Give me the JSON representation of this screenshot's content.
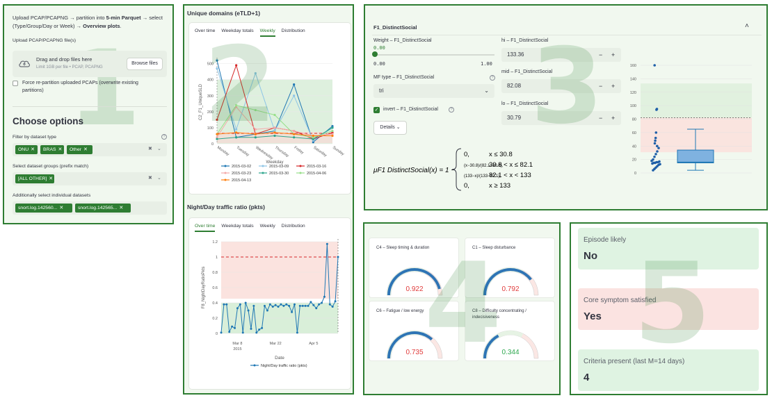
{
  "panel1": {
    "intro_a": "Upload PCAP/PCAPNG → partition into ",
    "intro_b": "5-min Parquet",
    "intro_c": " → select (Type/Group/Day or Week) → ",
    "intro_d": "Overview plots",
    "intro_e": ".",
    "upload_label": "Upload PCAP/PCAPNG file(s)",
    "drop_title": "Drag and drop files here",
    "drop_limit": "Limit 1GB per file • PCAP, PCAPNG",
    "browse_label": "Browse files",
    "force_label": "Force re-partition uploaded PCAPs (overwrite existing partitions)",
    "options_title": "Choose options",
    "filter_label": "Filter by dataset type",
    "type_tags": [
      "ONU",
      "BRAS",
      "Other"
    ],
    "groups_label": "Select dataset groups (prefix match)",
    "group_tags": [
      "[ALL OTHER]"
    ],
    "datasets_label": "Additionally select individual datasets",
    "dataset_tags": [
      "snort.log.142560...",
      "snort.log.142565..."
    ],
    "overlay_number": "1"
  },
  "panel2": {
    "top_title": "Unique domains (eTLD+1)",
    "top_tabs": [
      "Over time",
      "Weekday totals",
      "Weekly",
      "Distribution"
    ],
    "top_active_tab": 2,
    "top_ylabel": "C2_F1_UniqueSLD",
    "top_xlabel": "Weekday",
    "top_yticks": [
      "0",
      "100",
      "200",
      "300",
      "400",
      "500"
    ],
    "top_xticks": [
      "Monday",
      "Tuesday",
      "Wednesday",
      "Thursday",
      "Friday",
      "Saturday",
      "Sunday"
    ],
    "top_legend": [
      {
        "label": "2015-03-02",
        "color": "#1f77b4"
      },
      {
        "label": "2015-03-09",
        "color": "#8ec5e6"
      },
      {
        "label": "2015-03-16",
        "color": "#d62728"
      },
      {
        "label": "2015-03-23",
        "color": "#f4a9a8"
      },
      {
        "label": "2015-03-30",
        "color": "#2ca58d"
      },
      {
        "label": "2015-04-06",
        "color": "#98df8a"
      },
      {
        "label": "2015-04-13",
        "color": "#ff7f0e"
      }
    ],
    "bottom_title": "Night/Day traffic ratio (pkts)",
    "bottom_tabs": [
      "Over time",
      "Weekday totals",
      "Weekly",
      "Distribution"
    ],
    "bottom_active_tab": 0,
    "bottom_ylabel": "F8_NightDayRatioPkts",
    "bottom_xlabel": "Date",
    "bottom_yticks": [
      "0",
      "0.2",
      "0.4",
      "0.6",
      "0.8",
      "1",
      "1.2"
    ],
    "bottom_xticks": [
      "Mar 8",
      "Mar 22",
      "Apr 5"
    ],
    "bottom_xyear": "2015",
    "bottom_legend": "Night/Day traffic ratio (pkts)",
    "overlay_number": "2"
  },
  "panel3": {
    "expander_title": "F1_DistinctSocial",
    "weight_label": "Weight – F1_DistinctSocial",
    "weight_value": "0.00",
    "weight_min": "0.00",
    "weight_max": "1.00",
    "mf_label": "MF type – F1_DistinctSocial",
    "mf_value": "tri",
    "invert_label": "invert – F1_DistinctSocial",
    "details_label": "Details",
    "hi_label": "hi – F1_DistinctSocial",
    "hi_value": "133.36",
    "mid_label": "mid – F1_DistinctSocial",
    "mid_value": "82.08",
    "lo_label": "lo – F1_DistinctSocial",
    "lo_value": "30.79",
    "formula_lhs": "μF1 DistinctSocial(x) = 1 −",
    "formula_cases": [
      {
        "val": "0,",
        "cond": "x ≤ 30.8"
      },
      {
        "val": "(x−30.8)/(82.1−30.8),",
        "cond": "30.8 < x ≤ 82.1"
      },
      {
        "val": "(133−x)/(133−82.1),",
        "cond": "82.1 < x < 133"
      },
      {
        "val": "0,",
        "cond": "x ≥ 133"
      }
    ],
    "box_yticks": [
      "0",
      "20",
      "40",
      "60",
      "80",
      "100",
      "120",
      "140",
      "160"
    ],
    "overlay_number": "3"
  },
  "panel4": {
    "gauges": [
      {
        "title": "C4 – Sleep timing & duration",
        "value": "0.922",
        "color": "#e03b3b"
      },
      {
        "title": "C1 – Sleep disturbance",
        "value": "0.792",
        "color": "#e03b3b"
      },
      {
        "title": "C6 – Fatigue / low energy",
        "value": "0.735",
        "color": "#e03b3b"
      },
      {
        "title": "C8 – Difficulty concentrating / indecisiveness",
        "value": "0.344",
        "color": "#2ea84f"
      }
    ],
    "overlay_number": "4"
  },
  "panel5": {
    "metrics": [
      {
        "title": "Episode likely",
        "value": "No",
        "bg": "#dff3e2"
      },
      {
        "title": "Core symptom satisfied",
        "value": "Yes",
        "bg": "#fbe3e1"
      },
      {
        "title": "Criteria present (last M=14 days)",
        "value": "4",
        "bg": "#dff3e2"
      }
    ],
    "overlay_number": "5"
  },
  "chart_data": [
    {
      "type": "line",
      "title": "Unique domains (eTLD+1)",
      "xlabel": "Weekday",
      "ylabel": "C2_F1_UniqueSLD",
      "categories": [
        "Monday",
        "Tuesday",
        "Wednesday",
        "Thursday",
        "Friday",
        "Saturday",
        "Sunday"
      ],
      "ylim": [
        0,
        520
      ],
      "series": [
        {
          "name": "2015-03-02",
          "values": [
            520,
            40,
            60,
            80,
            370,
            10,
            110
          ]
        },
        {
          "name": "2015-03-09",
          "values": [
            470,
            90,
            440,
            80,
            300,
            20,
            100
          ]
        },
        {
          "name": "2015-03-16",
          "values": [
            150,
            490,
            60,
            100,
            80,
            30,
            70
          ]
        },
        {
          "name": "2015-03-23",
          "values": [
            40,
            230,
            90,
            100,
            80,
            50,
            60
          ]
        },
        {
          "name": "2015-03-30",
          "values": [
            30,
            40,
            40,
            50,
            40,
            30,
            100
          ]
        },
        {
          "name": "2015-04-06",
          "values": [
            60,
            240,
            210,
            180,
            60,
            40,
            80
          ]
        },
        {
          "name": "2015-04-13",
          "values": [
            60,
            70,
            60,
            70,
            60,
            50,
            50
          ]
        }
      ],
      "reference_line": 65
    },
    {
      "type": "line",
      "title": "Night/Day traffic ratio (pkts)",
      "xlabel": "Date",
      "ylabel": "F8_NightDayRatioPkts",
      "x": [
        "2015-03-02",
        "2015-03-03",
        "2015-03-04",
        "2015-03-05",
        "2015-03-06",
        "2015-03-07",
        "2015-03-08",
        "2015-03-09",
        "2015-03-10",
        "2015-03-11",
        "2015-03-12",
        "2015-03-13",
        "2015-03-14",
        "2015-03-15",
        "2015-03-16",
        "2015-03-17",
        "2015-03-18",
        "2015-03-19",
        "2015-03-20",
        "2015-03-21",
        "2015-03-22",
        "2015-03-23",
        "2015-03-24",
        "2015-03-25",
        "2015-03-26",
        "2015-03-27",
        "2015-03-28",
        "2015-03-29",
        "2015-03-30",
        "2015-03-31",
        "2015-04-01",
        "2015-04-02",
        "2015-04-03",
        "2015-04-04",
        "2015-04-05",
        "2015-04-06",
        "2015-04-07",
        "2015-04-08",
        "2015-04-09",
        "2015-04-10",
        "2015-04-11",
        "2015-04-12",
        "2015-04-13",
        "2015-04-14"
      ],
      "values": [
        0.01,
        0.38,
        0.38,
        0.02,
        0.09,
        0.07,
        0.33,
        0.38,
        0.01,
        0.4,
        0.3,
        0.06,
        0.36,
        0.01,
        0.05,
        0.07,
        0.36,
        0.3,
        0.38,
        0.35,
        0.37,
        0.35,
        0.38,
        0.36,
        0.38,
        0.36,
        0.28,
        0.38,
        0.01,
        0.36,
        0.36,
        0.36,
        0.36,
        0.41,
        0.37,
        0.33,
        0.38,
        0.4,
        0.48,
        1.17,
        0.38,
        0.35,
        0.42,
        1.0
      ],
      "ylim": [
        0,
        1.2
      ],
      "reference_line": 1.0,
      "series_name": "Night/Day traffic ratio (pkts)"
    },
    {
      "type": "scatter",
      "title": "F1_DistinctSocial",
      "ylim": [
        0,
        165
      ],
      "box": {
        "min": 4,
        "q1": 15,
        "median": 16,
        "q3": 34,
        "max": 65
      },
      "points": [
        160,
        95,
        94,
        60,
        52,
        48,
        44,
        40,
        37,
        32,
        28,
        24,
        20,
        18,
        17,
        16,
        16,
        15,
        15,
        14,
        13,
        12,
        10,
        8,
        6,
        4
      ],
      "reference_lines": [
        30.8,
        82.1,
        133
      ]
    }
  ]
}
